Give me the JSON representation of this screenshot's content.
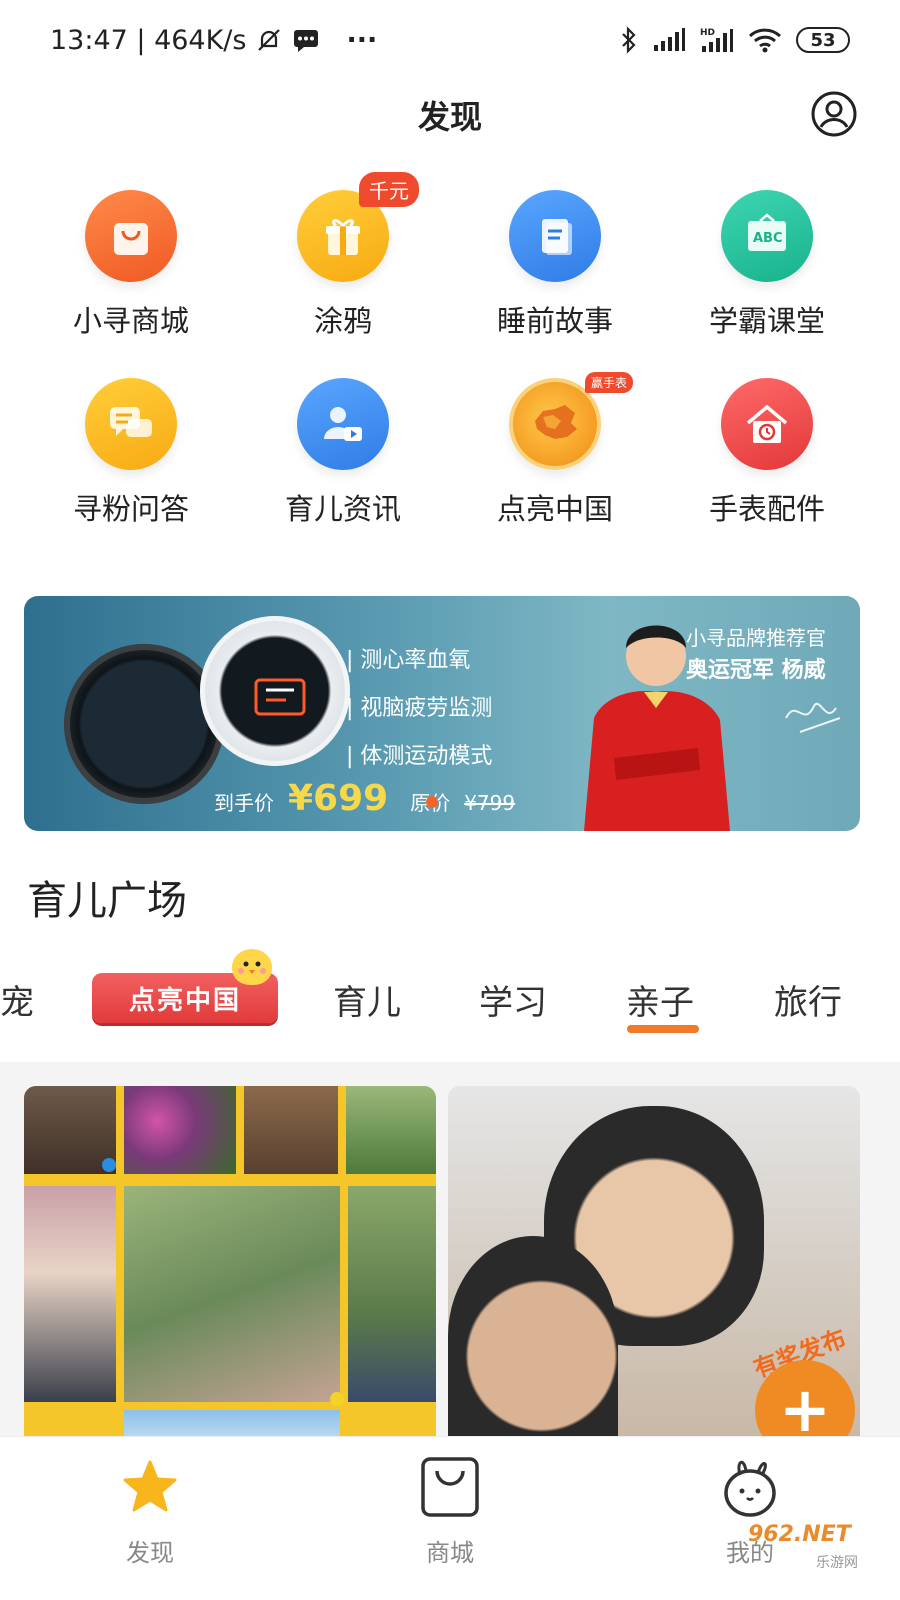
{
  "status_bar": {
    "time_speed": "13:47 | 464K/s",
    "more": "···",
    "battery": "53"
  },
  "header": {
    "title": "发现"
  },
  "grid": {
    "items": [
      {
        "label": "小寻商城",
        "icon": "shopping-bag-icon",
        "color": "#f3723a"
      },
      {
        "label": "涂鸦",
        "icon": "gift-icon",
        "color": "#f9b81c",
        "badge": "千元"
      },
      {
        "label": "睡前故事",
        "icon": "book-icon",
        "color": "#3d8ff0"
      },
      {
        "label": "学霸课堂",
        "icon": "abc-board-icon",
        "color": "#22c0a0"
      },
      {
        "label": "寻粉问答",
        "icon": "chat-bubbles-icon",
        "color": "#f9b81c"
      },
      {
        "label": "育儿资讯",
        "icon": "person-video-icon",
        "color": "#3d8ff0"
      },
      {
        "label": "点亮中国",
        "icon": "china-map-icon",
        "color": "#f5a21d",
        "badge": "赢手表"
      },
      {
        "label": "手表配件",
        "icon": "house-watch-icon",
        "color": "#ef4444"
      }
    ]
  },
  "banner": {
    "features": [
      "| 测心率血氧",
      "| 视脑疲劳监测",
      "| 体测运动模式"
    ],
    "price_label": "到手价",
    "price": "¥699",
    "orig_label": "原价",
    "orig_price": "¥799",
    "endorser_title": "小寻品牌推荐官",
    "endorser_name": "奥运冠军 杨威"
  },
  "section": {
    "title": "育儿广场"
  },
  "tabs": {
    "partial": "萌宠",
    "special": "点亮中国",
    "items": [
      "育儿",
      "学习",
      "亲子",
      "旅行"
    ],
    "active": "亲子"
  },
  "fab": {
    "label": "有奖发布",
    "plus": "+"
  },
  "bottom_nav": {
    "items": [
      {
        "label": "发现",
        "icon": "star-icon"
      },
      {
        "label": "商城",
        "icon": "bag-icon"
      },
      {
        "label": "我的",
        "icon": "bunny-icon"
      }
    ]
  },
  "watermark": {
    "main": "962.NET",
    "sub": "乐游网"
  }
}
